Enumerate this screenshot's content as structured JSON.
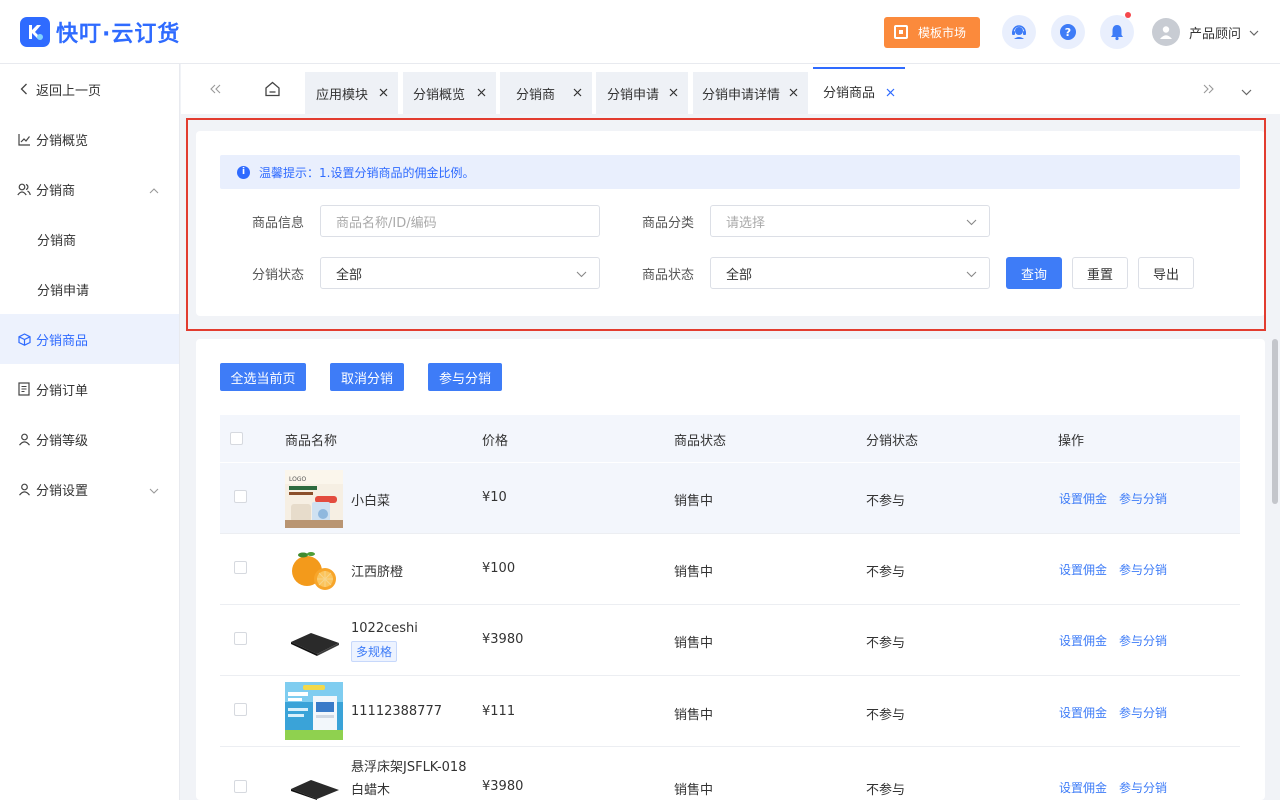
{
  "app": {
    "name": "快叮·云订货",
    "brand_color": "#2f6bff"
  },
  "header": {
    "market_label": "模板市场",
    "user_name": "产品顾问",
    "icons": [
      "support-icon",
      "help-icon",
      "bell-icon",
      "user-avatar-icon"
    ]
  },
  "sidebar": {
    "items": [
      {
        "label": "返回上一页",
        "icon": "back-icon"
      },
      {
        "label": "分销概览",
        "icon": "chart-icon"
      },
      {
        "label": "分销商",
        "icon": "users-icon",
        "expanded": true
      },
      {
        "label": "分销商",
        "sub": true
      },
      {
        "label": "分销申请",
        "sub": true
      },
      {
        "label": "分销商品",
        "icon": "box-icon",
        "active": true
      },
      {
        "label": "分销订单",
        "icon": "order-icon"
      },
      {
        "label": "分销等级",
        "icon": "level-icon"
      },
      {
        "label": "分销设置",
        "icon": "settings-icon",
        "expanded": false
      }
    ]
  },
  "tabs": {
    "items": [
      {
        "label": "应用模块"
      },
      {
        "label": "分销概览"
      },
      {
        "label": "分销商"
      },
      {
        "label": "分销申请"
      },
      {
        "label": "分销申请详情"
      },
      {
        "label": "分销商品",
        "active": true
      }
    ]
  },
  "filter": {
    "tip": "温馨提示：1.设置分销商品的佣金比例。",
    "product_info_label": "商品信息",
    "product_info_placeholder": "商品名称/ID/编码",
    "category_label": "商品分类",
    "category_placeholder": "请选择",
    "dist_status_label": "分销状态",
    "dist_status_value": "全部",
    "product_status_label": "商品状态",
    "product_status_value": "全部",
    "query_label": "查询",
    "reset_label": "重置",
    "export_label": "导出",
    "highlight_color": "#e23c2f"
  },
  "actions": {
    "select_page": "全选当前页",
    "cancel_dist": "取消分销",
    "join_dist": "参与分销"
  },
  "table": {
    "headers": {
      "name": "商品名称",
      "price": "价格",
      "status": "商品状态",
      "dist_status": "分销状态",
      "ops": "操作"
    },
    "rows": [
      {
        "name": "小白菜",
        "price": "¥10",
        "status": "销售中",
        "dist_status": "不参与",
        "op1": "设置佣金",
        "op2": "参与分销",
        "thumb": "poster"
      },
      {
        "name": "江西脐橙",
        "price": "¥100",
        "status": "销售中",
        "dist_status": "不参与",
        "op1": "设置佣金",
        "op2": "参与分销",
        "thumb": "orange"
      },
      {
        "name": "1022ceshi",
        "tag": "多规格",
        "price": "¥3980",
        "status": "销售中",
        "dist_status": "不参与",
        "op1": "设置佣金",
        "op2": "参与分销",
        "thumb": "mat"
      },
      {
        "name": "11112388777",
        "price": "¥111",
        "status": "销售中",
        "dist_status": "不参与",
        "op1": "设置佣金",
        "op2": "参与分销",
        "thumb": "box"
      },
      {
        "name": "悬浮床架JSFLK-018",
        "name2": "白蜡木",
        "price": "¥3980",
        "status": "销售中",
        "dist_status": "不参与",
        "op1": "设置佣金",
        "op2": "参与分销",
        "thumb": "mat"
      }
    ]
  }
}
